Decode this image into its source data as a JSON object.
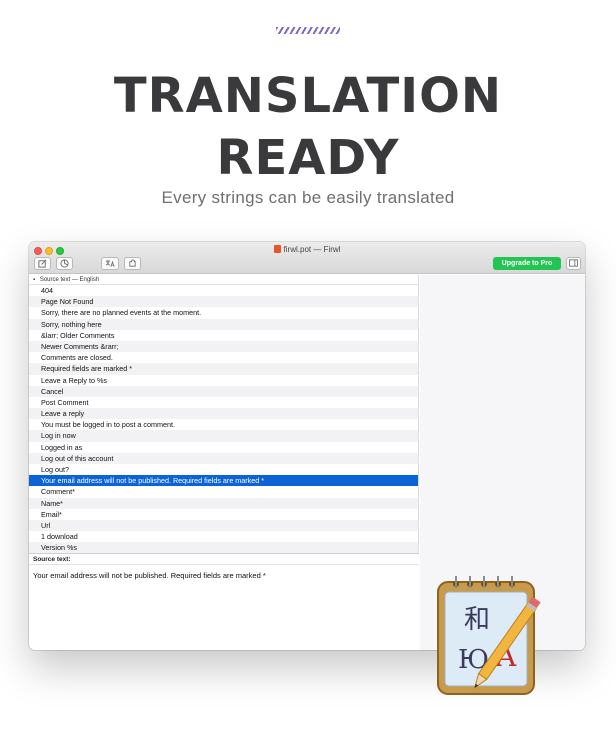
{
  "hero": {
    "line1": "TRANSLATION",
    "line2": "READY",
    "subtitle": "Every strings can be easily translated"
  },
  "window": {
    "title": "firwl.pot — Firwl",
    "upgrade_label": "Upgrade to Pro",
    "list_header": "Source text — English",
    "rows": [
      "404",
      "Page Not Found",
      "Sorry, there are no planned events at the moment.",
      "Sorry, nothing here",
      "&larr; Older Comments",
      "Newer Comments &rarr;",
      "Comments are closed.",
      "Required fields are marked *",
      "Leave a Reply to %s",
      "Cancel",
      "Post Comment",
      "Leave a reply",
      "You must be logged in to post a comment.",
      "Log in now",
      "Logged in as",
      "Log out of this account",
      "Log out?",
      "Your email address will not be published. Required fields are marked *",
      "Comment*",
      "Name*",
      "Email*",
      "Url",
      "1 download",
      "Version %s"
    ],
    "selected_row_index": 17,
    "source_label": "Source text:",
    "source_text": "Your email address will not be published. Required fields are marked *"
  },
  "colors": {
    "selection": "#0a64d8",
    "upgrade": "#23c552",
    "accent_stripes": "#7a6cc8"
  },
  "app_icon": {
    "glyph_1": "和",
    "glyph_2": "Ю",
    "glyph_3": "À"
  }
}
